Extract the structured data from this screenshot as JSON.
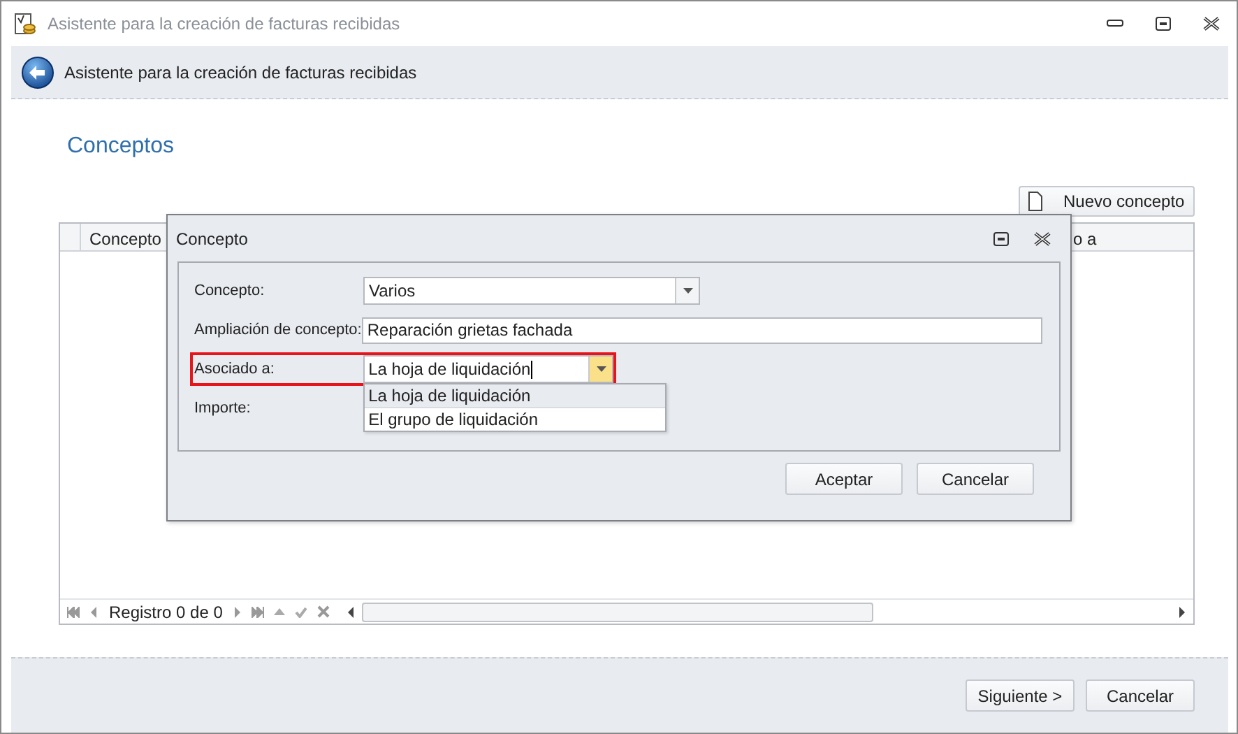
{
  "window": {
    "title": "Asistente para la creación de facturas recibidas"
  },
  "header": {
    "title": "Asistente para la creación de facturas recibidas"
  },
  "section_title": "Conceptos",
  "new_button": "Nuevo concepto",
  "grid": {
    "columns": [
      "Concepto",
      "o a"
    ],
    "navigator": "Registro 0 de 0"
  },
  "dialog": {
    "title": "Concepto",
    "fields": [
      {
        "kind": "combo",
        "label": "Concepto:",
        "value": "Varios",
        "highlighted": false,
        "expanded": false
      },
      {
        "kind": "text",
        "label": "Ampliación de concepto:",
        "value": "Reparación grietas fachada",
        "highlighted": false
      },
      {
        "kind": "combo",
        "label": "Asociado a:",
        "value": "La hoja de liquidación",
        "highlighted": true,
        "expanded": true,
        "options": [
          {
            "label": "La hoja de liquidación",
            "selected": true
          },
          {
            "label": "El grupo de liquidación",
            "selected": false
          }
        ]
      },
      {
        "kind": "label",
        "label": "Importe:",
        "highlighted": false
      }
    ],
    "buttons": [
      "Aceptar",
      "Cancelar"
    ]
  },
  "footer_buttons": [
    "Siguiente >",
    "Cancelar"
  ]
}
